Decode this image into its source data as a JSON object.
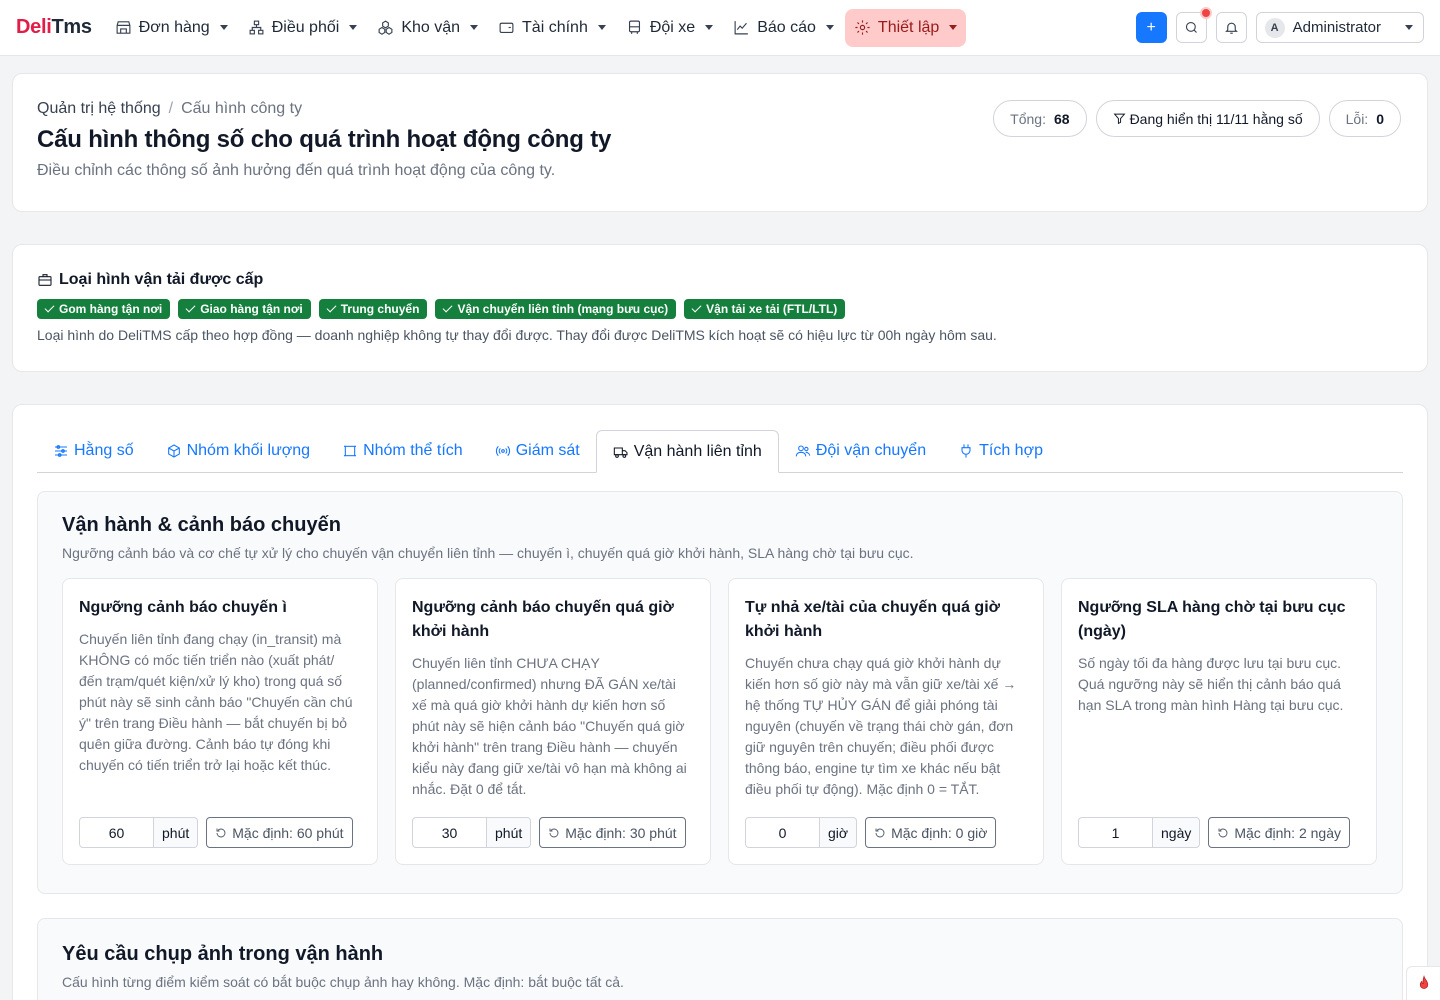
{
  "brand": {
    "part1": "Deli",
    "part2": "Tms"
  },
  "nav": {
    "items": [
      {
        "label": "Đơn hàng",
        "icon": "store-icon"
      },
      {
        "label": "Điều phối",
        "icon": "network-icon"
      },
      {
        "label": "Kho vận",
        "icon": "boxes-icon"
      },
      {
        "label": "Tài chính",
        "icon": "wallet-icon"
      },
      {
        "label": "Đội xe",
        "icon": "bus-icon"
      },
      {
        "label": "Báo cáo",
        "icon": "chart-line-icon"
      },
      {
        "label": "Thiết lập",
        "icon": "gear-icon"
      }
    ],
    "user": {
      "avatar": "A",
      "name": "Administrator"
    },
    "add_label": "+"
  },
  "header": {
    "breadcrumb": {
      "parent": "Quản trị hệ thống",
      "sep": "/",
      "current": "Cấu hình công ty"
    },
    "title": "Cấu hình thông số cho quá trình hoạt động công ty",
    "subtitle": "Điều chỉnh các thông số ảnh hưởng đến quá trình hoạt động của công ty.",
    "stats": {
      "total_label": "Tổng:",
      "total_value": "68",
      "filter_label": "Đang hiển thị 11/11 hằng số",
      "error_label": "Lỗi:",
      "error_value": "0"
    }
  },
  "transport": {
    "title": "Loại hình vận tải được cấp",
    "badges": [
      "Gom hàng tận nơi",
      "Giao hàng tận nơi",
      "Trung chuyển",
      "Vận chuyển liên tỉnh (mạng bưu cục)",
      "Vận tải xe tải (FTL/LTL)"
    ],
    "note": "Loại hình do DeliTMS cấp theo hợp đồng — doanh nghiệp không tự thay đổi được. Thay đổi được DeliTMS kích hoạt sẽ có hiệu lực từ 00h ngày hôm sau."
  },
  "tabs": [
    {
      "label": "Hằng số",
      "icon": "sliders-icon"
    },
    {
      "label": "Nhóm khối lượng",
      "icon": "package-icon"
    },
    {
      "label": "Nhóm thể tích",
      "icon": "frame-icon"
    },
    {
      "label": "Giám sát",
      "icon": "broadcast-icon"
    },
    {
      "label": "Vận hành liên tỉnh",
      "icon": "truck-icon"
    },
    {
      "label": "Đội vận chuyển",
      "icon": "users-icon"
    },
    {
      "label": "Tích hợp",
      "icon": "plug-icon"
    }
  ],
  "ops": {
    "title": "Vận hành & cảnh báo chuyến",
    "subtitle": "Ngưỡng cảnh báo và cơ chế tự xử lý cho chuyến vận chuyển liên tỉnh — chuyến ì, chuyến quá giờ khởi hành, SLA hàng chờ tại bưu cục.",
    "cards": [
      {
        "title": "Ngưỡng cảnh báo chuyến ì",
        "desc": "Chuyến liên tỉnh đang chạy (in_transit) mà KHÔNG có mốc tiến triển nào (xuất phát/ đến trạm/quét kiện/xử lý kho) trong quá số phút này sẽ sinh cảnh báo \"Chuyến cần chú ý\" trên trang Điều hành — bắt chuyến bị bỏ quên giữa đường. Cảnh báo tự đóng khi chuyến có tiến triển trở lại hoặc kết thúc.",
        "value": "60",
        "unit": "phút",
        "reset": "Mặc định: 60 phút"
      },
      {
        "title": "Ngưỡng cảnh báo chuyến quá giờ khởi hành",
        "desc": "Chuyến liên tỉnh CHƯA CHẠY (planned/confirmed) nhưng ĐÃ GÁN xe/tài xế mà quá giờ khởi hành dự kiến hơn số phút này sẽ hiện cảnh báo \"Chuyến quá giờ khởi hành\" trên trang Điều hành — chuyến kiểu này đang giữ xe/tài vô hạn mà không ai nhắc. Đặt 0 để tắt.",
        "value": "30",
        "unit": "phút",
        "reset": "Mặc định: 30 phút"
      },
      {
        "title": "Tự nhả xe/tài của chuyến quá giờ khởi hành",
        "desc": "Chuyến chưa chạy quá giờ khởi hành dự kiến hơn số giờ này mà vẫn giữ xe/tài xế → hệ thống TỰ HỦY GÁN để giải phóng tài nguyên (chuyến về trạng thái chờ gán, đơn giữ nguyên trên chuyến; điều phối được thông báo, engine tự tìm xe khác nếu bật điều phối tự động). Mặc định 0 = TẮT.",
        "value": "0",
        "unit": "giờ",
        "reset": "Mặc định: 0 giờ"
      },
      {
        "title": "Ngưỡng SLA hàng chờ tại bưu cục (ngày)",
        "desc": "Số ngày tối đa hàng được lưu tại bưu cục. Quá ngưỡng này sẽ hiển thị cảnh báo quá hạn SLA trong màn hình Hàng tại bưu cục.",
        "value": "1",
        "unit": "ngày",
        "reset": "Mặc định: 2 ngày"
      }
    ]
  },
  "photo": {
    "title": "Yêu cầu chụp ảnh trong vận hành",
    "subtitle": "Cấu hình từng điểm kiểm soát có bắt buộc chụp ảnh hay không. Mặc định: bắt buộc tất cả."
  },
  "colors": {
    "primary": "#1677ff",
    "brand": "#e11d48",
    "success": "#15803d",
    "active_nav_bg": "#fecaca"
  }
}
